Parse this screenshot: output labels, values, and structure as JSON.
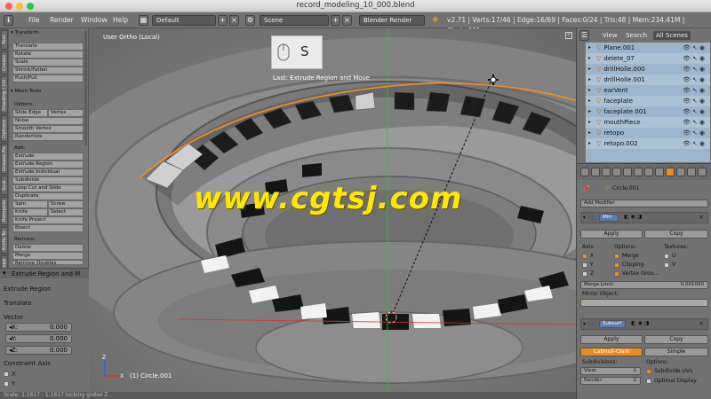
{
  "window": {
    "title": "record_modeling_10_000.blend"
  },
  "menu": {
    "file": "File",
    "render": "Render",
    "window": "Window",
    "help": "Help",
    "screen": "Default",
    "scene": "Scene",
    "engine": "Blender Render",
    "stats": "v2.71 | Verts:17/46 | Edge:16/69 | Faces:0/24 | Tris:48 | Mem:234.41M | Circle.001"
  },
  "vtabs": [
    "Tool",
    "Create",
    "Shading / UV",
    "Options",
    "Grease Pe",
    "Scul",
    "Retopolo",
    "Knife To",
    "Retopo"
  ],
  "tools": {
    "transform_header": "Transform",
    "translate": "Translate",
    "rotate": "Rotate",
    "scale": "Scale",
    "shrink": "Shrink/Fatten",
    "push": "Push/Pull",
    "meshtools_header": "Mesh Tools",
    "deform": "Deform:",
    "slide_edge": "Slide Edge",
    "vertex": "Vertex",
    "noise": "Noise",
    "smooth": "Smooth Vertex",
    "randomize": "Randomize",
    "add": "Add:",
    "extrude": "Extrude",
    "extrude_region": "Extrude Region",
    "extrude_individual": "Extrude Individual",
    "subdivide": "Subdivide",
    "loopcut": "Loop Cut and Slide",
    "duplicate": "Duplicate",
    "spin": "Spin",
    "screw": "Screw",
    "knife": "Knife",
    "select": "Select",
    "knife_project": "Knife Project",
    "bisect": "Bisect",
    "remove": "Remove:",
    "delete": "Delete",
    "merge": "Merge",
    "remove_doubles": "Remove Doubles"
  },
  "operator": {
    "header": "Extrude Region and M",
    "name": "Extrude Region",
    "op": "Translate",
    "vector": "Vector",
    "x_label": "X:",
    "x": "0.000",
    "y_label": "Y:",
    "y": "0.000",
    "z_label": "Z:",
    "z": "0.000",
    "constraint": "Constraint Axis",
    "cx": "X",
    "cy": "Y"
  },
  "viewport": {
    "view_name": "User Ortho (Local)",
    "key": "S",
    "last_op": "Last: Extrude Region and Move",
    "object": "(1) Circle.001",
    "watermark": "www.cgtsj.com"
  },
  "status": {
    "text": "Scale: 1.1617 : 1.1617 locking global Z"
  },
  "outliner": {
    "tab_view": "View",
    "tab_search": "Search",
    "tab_all": "All Scenes",
    "items": [
      "Plane.001",
      "delete_07",
      "drillHolle.000",
      "drillHolle.001",
      "earVent",
      "faceplate",
      "faceplate.001",
      "mouthPiece",
      "retopo",
      "retopo.002"
    ]
  },
  "properties": {
    "object": "Circle.001",
    "add_modifier": "Add Modifier",
    "mirror": "Mirr",
    "apply": "Apply",
    "copy": "Copy",
    "axis": "Axis:",
    "options": "Options:",
    "textures": "Textures:",
    "x": "X",
    "y": "Y",
    "z": "Z",
    "merge": "Merge",
    "clipping": "Clipping",
    "vertex_groups": "Vertex Grou...",
    "u": "U",
    "v": "V",
    "merge_limit": "Merge Limit:",
    "merge_limit_val": "0.001000",
    "mirror_object": "Mirror Object:",
    "subsurf": "Subsurf",
    "apply2": "Apply",
    "copy2": "Copy",
    "catmull": "Catmull-Clark",
    "simple": "Simple",
    "subdivisions": "Subdivisions:",
    "options2": "Options:",
    "view": "View:",
    "view_val": "1",
    "render": "Render:",
    "render_val": "2",
    "subdivide_uvs": "Subdivide UVs",
    "optimal": "Optimal Display"
  },
  "colors": {
    "accent": "#f08c1e",
    "outliner_bg": "#9cb4cc",
    "panel": "#727272"
  }
}
